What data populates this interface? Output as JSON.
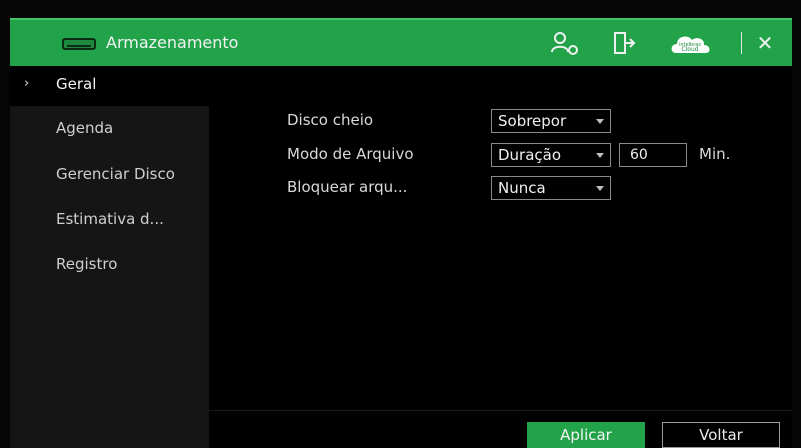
{
  "header": {
    "title": "Armazenamento",
    "cloud_label_top": "intelbras",
    "cloud_label_bottom": "Cloud",
    "close": "✕"
  },
  "sidebar": {
    "items": [
      {
        "label": "Geral",
        "active": true,
        "arrow": "›"
      },
      {
        "label": "Agenda"
      },
      {
        "label": "Gerenciar Disco"
      },
      {
        "label": "Estimativa d..."
      },
      {
        "label": "Registro"
      }
    ]
  },
  "form": {
    "disk_full": {
      "label": "Disco cheio",
      "value": "Sobrepor"
    },
    "file_mode": {
      "label": "Modo de Arquivo",
      "value": "Duração",
      "duration": "60",
      "unit": "Min."
    },
    "lock_files": {
      "label": "Bloquear arqu...",
      "value": "Nunca"
    }
  },
  "buttons": {
    "apply": "Aplicar",
    "back": "Voltar"
  },
  "colors": {
    "accent": "#22a34a",
    "sidebar_bg": "#151515",
    "background": "#000000"
  }
}
